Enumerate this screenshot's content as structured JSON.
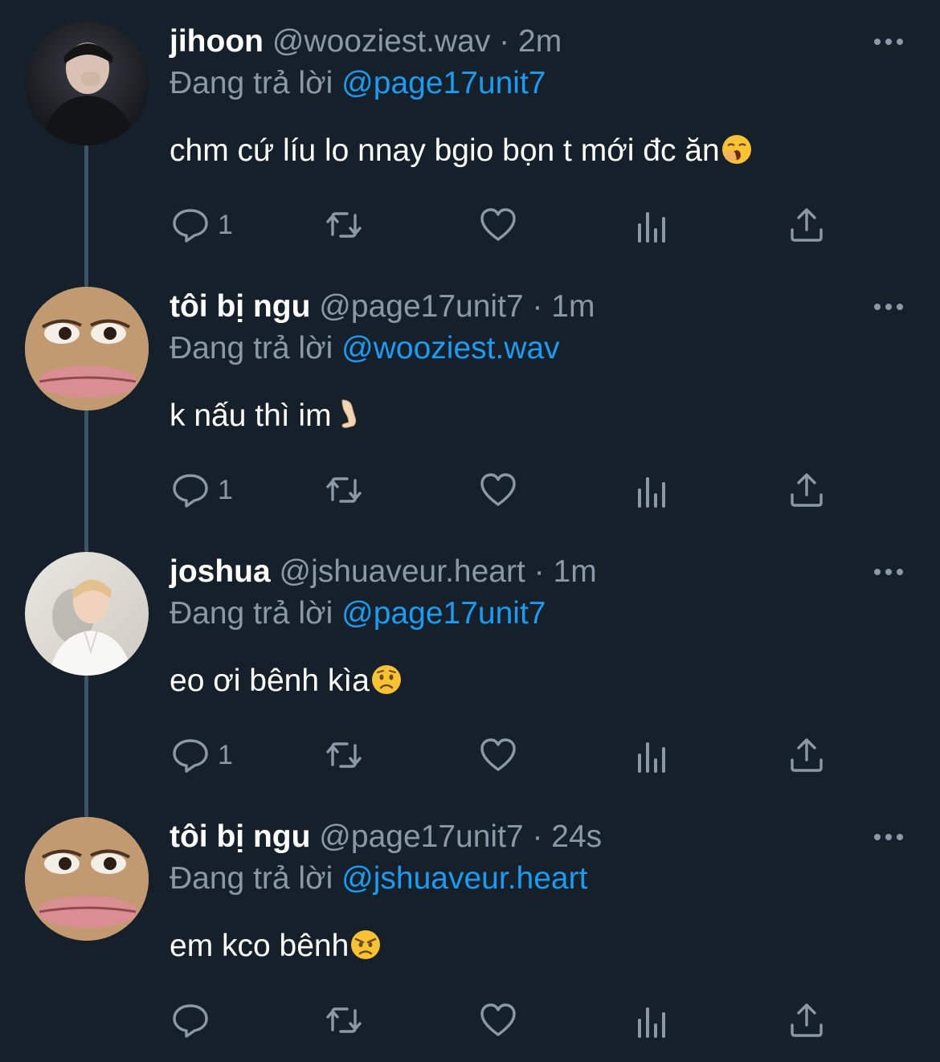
{
  "colors": {
    "background": "#15202b",
    "muted": "#8b98a5",
    "link": "#1d9bf0",
    "text": "#ffffff",
    "thread_line": "#3d5466"
  },
  "tweets": [
    {
      "name": "jihoon",
      "handle": "@wooziest.wav",
      "separator": "·",
      "time": "2m",
      "replying_label": "Đang trả lời",
      "replying_to": "@page17unit7",
      "text": "chm cứ líu lo nnay bgio bọn t mới đc ăn",
      "emoji": "yawning-face",
      "reply_count": "1",
      "avatar": "photo-dark-portrait"
    },
    {
      "name": "tôi bị ngu",
      "handle": "@page17unit7",
      "separator": "·",
      "time": "1m",
      "replying_label": "Đang trả lời",
      "replying_to": "@wooziest.wav",
      "text": "k nấu thì im",
      "emoji": "leg",
      "reply_count": "1",
      "avatar": "meme-face"
    },
    {
      "name": "joshua",
      "handle": "@jshuaveur.heart",
      "separator": "·",
      "time": "1m",
      "replying_label": "Đang trả lời",
      "replying_to": "@page17unit7",
      "text": "eo ơi bênh kìa",
      "emoji": "worried-face",
      "reply_count": "1",
      "avatar": "photo-light-portrait"
    },
    {
      "name": "tôi bị ngu",
      "handle": "@page17unit7",
      "separator": "·",
      "time": "24s",
      "replying_label": "Đang trả lời",
      "replying_to": "@jshuaveur.heart",
      "text": "em kco bênh",
      "emoji": "angry-face",
      "reply_count": "",
      "avatar": "meme-face"
    }
  ]
}
